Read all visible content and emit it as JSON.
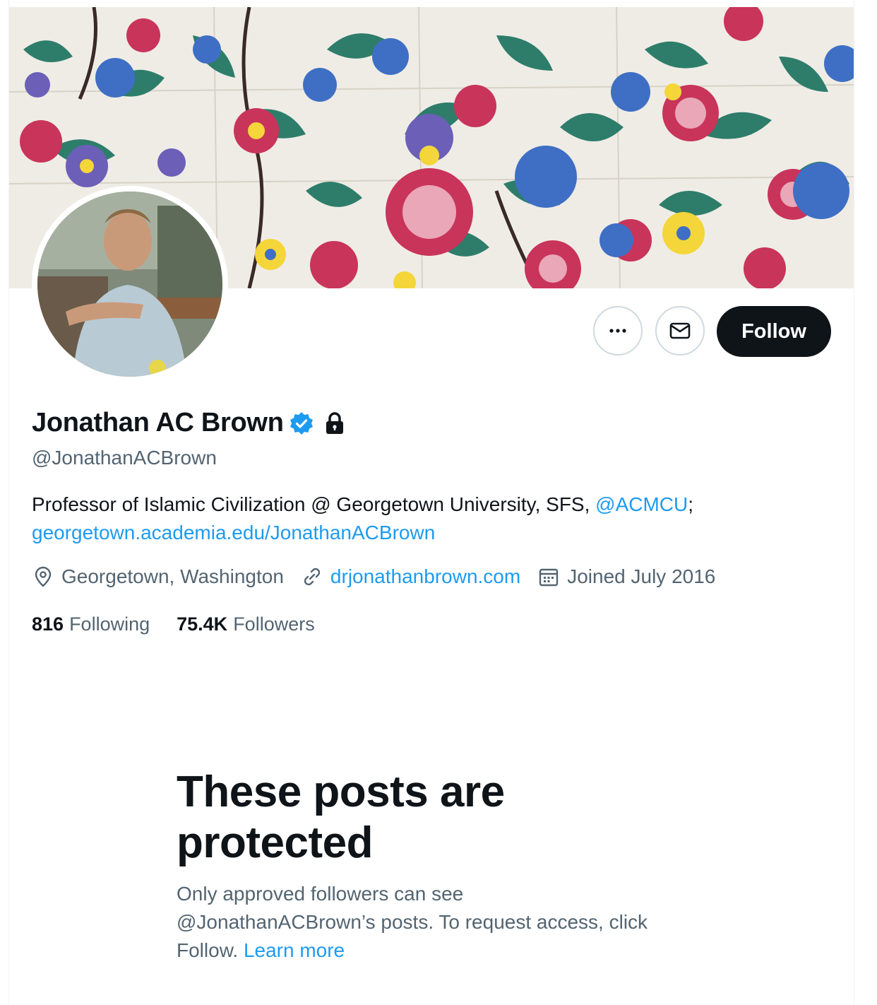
{
  "profile": {
    "display_name": "Jonathan AC Brown",
    "handle": "@JonathanACBrown",
    "bio_text": "Professor of Islamic Civilization @ Georgetown University, SFS, ",
    "bio_mention": "@ACMCU",
    "bio_after": ";",
    "bio_link": "georgetown.academia.edu/JonathanACBrown",
    "location": "Georgetown, Washington",
    "website": "drjonathanbrown.com",
    "joined": "Joined July 2016",
    "following_count": "816",
    "following_label": "Following",
    "followers_count": "75.4K",
    "followers_label": "Followers"
  },
  "actions": {
    "more_icon": "more-icon",
    "message_icon": "envelope-icon",
    "follow_label": "Follow"
  },
  "protected": {
    "title": "These posts are protected",
    "text_before": "Only approved followers can see @JonathanACBrown’s posts. To request access, click Follow. ",
    "learn_more": "Learn more"
  },
  "colors": {
    "link": "#1d9bf0",
    "muted": "#536471",
    "text": "#0f1419",
    "verified": "#1d9bf0"
  }
}
